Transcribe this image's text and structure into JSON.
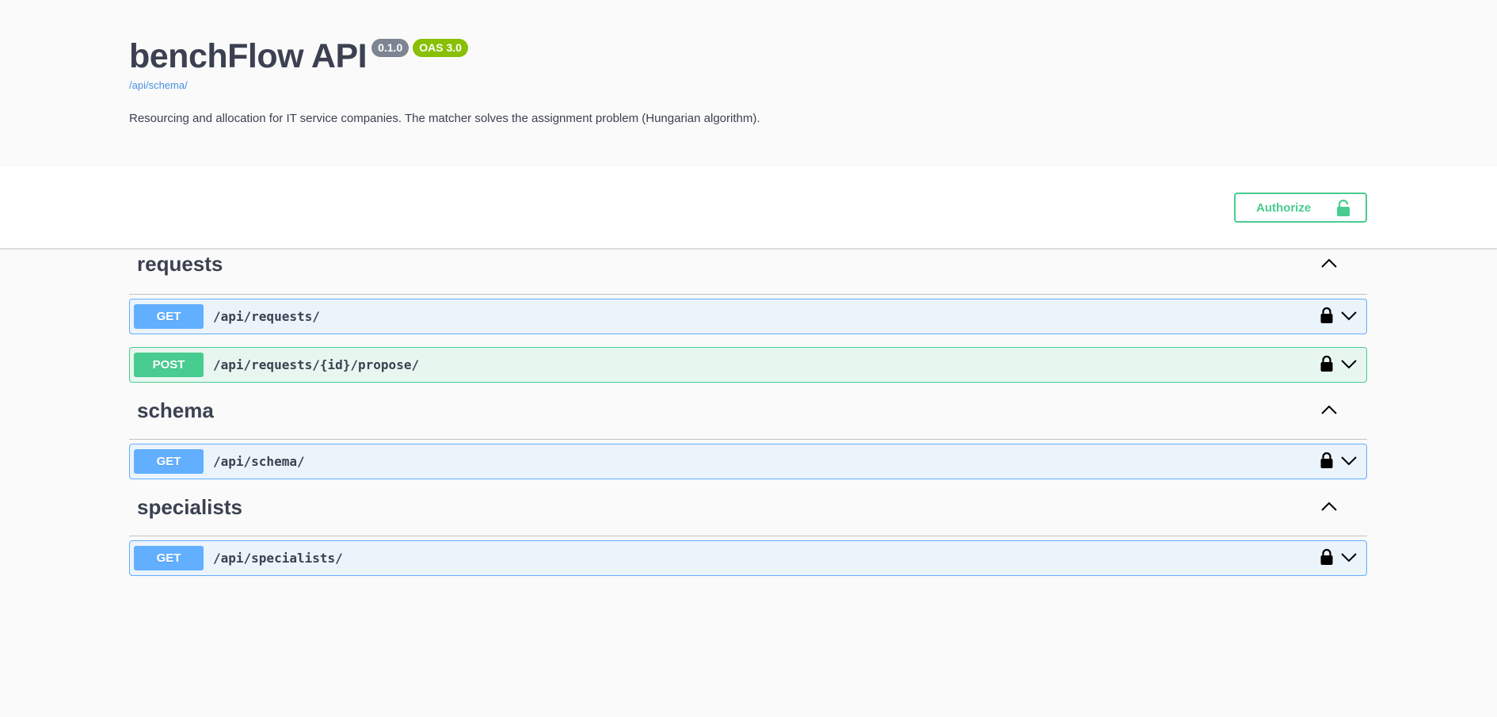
{
  "info": {
    "title": "benchFlow API",
    "version": "0.1.0",
    "oas": "OAS 3.0",
    "spec_url": "/api/schema/",
    "description": "Resourcing and allocation for IT service companies. The matcher solves the assignment problem (Hungarian algorithm)."
  },
  "auth": {
    "label": "Authorize",
    "icon": "lock-open-icon"
  },
  "colors": {
    "get": "#61affe",
    "post": "#49cc90",
    "authorize": "#49cc90"
  },
  "tags": [
    {
      "name": "requests",
      "ops": [
        {
          "method": "GET",
          "path": "/api/requests/"
        },
        {
          "method": "POST",
          "path": "/api/requests/{id}/propose/"
        }
      ]
    },
    {
      "name": "schema",
      "ops": [
        {
          "method": "GET",
          "path": "/api/schema/"
        }
      ]
    },
    {
      "name": "specialists",
      "ops": [
        {
          "method": "GET",
          "path": "/api/specialists/"
        }
      ]
    }
  ]
}
